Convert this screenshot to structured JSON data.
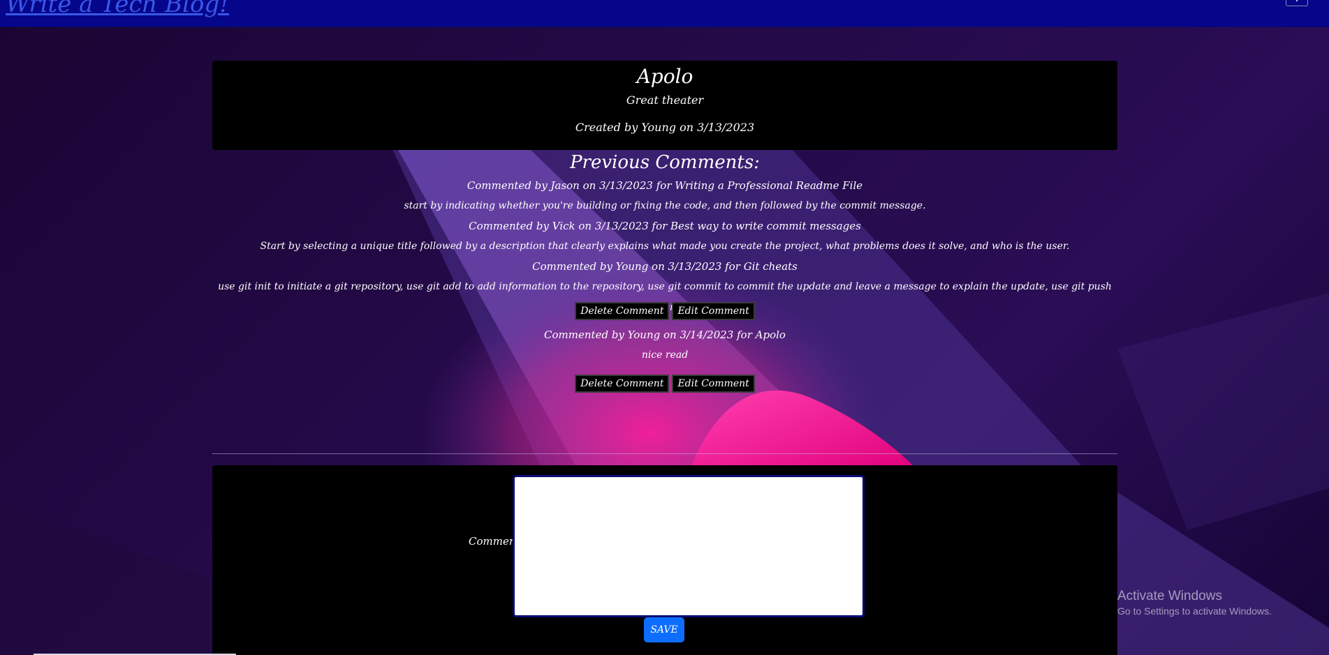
{
  "header": {
    "site_title": "Write a Tech Blog!"
  },
  "post": {
    "title": "Apolo",
    "description": "Great theater",
    "meta": "Created by Young on 3/13/2023"
  },
  "comments_section": {
    "heading": "Previous Comments:",
    "comments": [
      {
        "meta": "Commented by Jason on 3/13/2023 for Writing a Professional Readme File",
        "text": "start by indicating whether you're building or fixing the code, and then followed by the commit message."
      },
      {
        "meta": "Commented by Vick on 3/13/2023 for Best way to write commit messages",
        "text": "Start by selecting a unique title followed by a description that clearly explains what made you create the project, what problems does it solve, and who is the user."
      },
      {
        "meta": "Commented by Young on 3/13/2023 for Git cheats",
        "text": "use git init to initiate a git repository, use git add to add information to the repository, use git commit to commit the update and leave a message to explain the update, use git push to push the data remotely to github."
      },
      {
        "meta": "Commented by Young on 3/14/2023 for Apolo",
        "text": "nice read"
      }
    ],
    "delete_label": "Delete Comment",
    "edit_label": "Edit Comment"
  },
  "form": {
    "comment_label": "Comment:",
    "comment_value": "",
    "save_label": "SAVE"
  },
  "os_overlay": {
    "activate_title": "Activate Windows",
    "activate_subtitle": "Go to Settings to activate Windows."
  },
  "colors": {
    "header_bg": "#05068a",
    "card_bg": "#000000",
    "save_button": "#0d6efd",
    "accent_pink": "#ff0f8f",
    "accent_purple": "#5a3c9a"
  }
}
